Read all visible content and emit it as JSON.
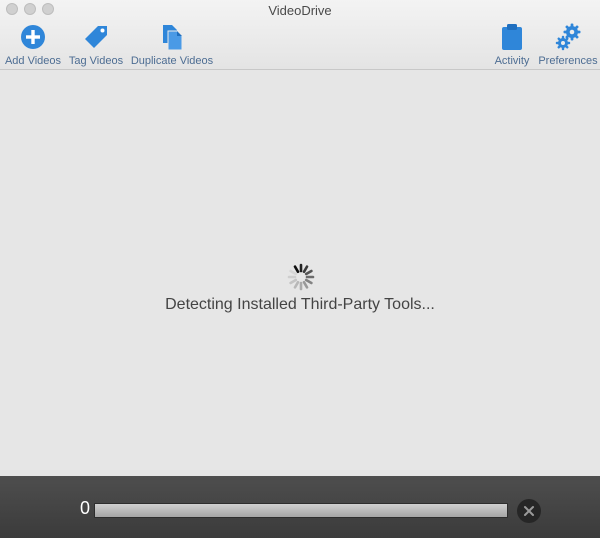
{
  "window": {
    "title": "VideoDrive"
  },
  "toolbar": {
    "add_videos": {
      "label": "Add Videos",
      "icon": "plus-circle-icon"
    },
    "tag_videos": {
      "label": "Tag Videos",
      "icon": "tag-icon"
    },
    "duplicate_videos": {
      "label": "Duplicate Videos",
      "icon": "duplicate-documents-icon"
    },
    "activity": {
      "label": "Activity",
      "icon": "clipboard-icon"
    },
    "preferences": {
      "label": "Preferences",
      "icon": "gears-icon"
    }
  },
  "main": {
    "status_text": "Detecting Installed Third-Party Tools...",
    "spinner_icon": "loading-spinner-icon"
  },
  "footer": {
    "count": "0",
    "progress_fraction": 0,
    "cancel_icon": "close-icon"
  },
  "colors": {
    "accent": "#2f86d9",
    "label": "#4d6d93",
    "footer_bg": "#444444"
  }
}
